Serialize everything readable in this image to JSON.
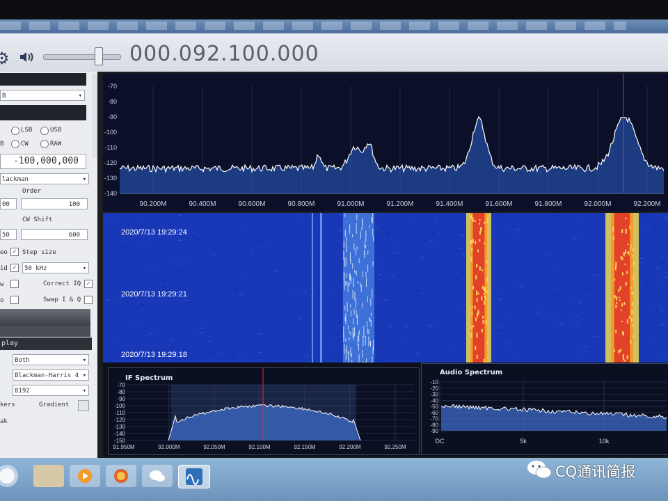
{
  "toolbar": {
    "frequency": "000.092.100.000",
    "volume_level": 0.75
  },
  "left_panel": {
    "modes": [
      "LSB",
      "USB",
      "CW",
      "RAW"
    ],
    "partial_labels": [
      "B"
    ],
    "frequency_value": "-100,000,000",
    "window_select": "lackman",
    "order_label": "Order",
    "order_value": "100",
    "filter_partial": "00",
    "cw_shift_label": "CW Shift",
    "cw_shift_value": "600",
    "cw_partial": "50",
    "step_label": "Step size",
    "step_partial_label": "eo",
    "step_size": "50 kHz",
    "id_partial": "id",
    "correct_iq": "Correct IQ",
    "correct_partial": "w",
    "swap_iq": "Swap I & Q",
    "swap_partial": "o",
    "display_header": "play",
    "display_mode": "Both",
    "fft_window": "Blackman-Harris 4",
    "fft_size": "8192",
    "markers_partial": "kers",
    "gradient_label": "Gradient",
    "peak_partial": "ak"
  },
  "main_spectrum": {
    "y_ticks": [
      "-70",
      "-80",
      "-90",
      "-100",
      "-110",
      "-120",
      "-130",
      "-140"
    ],
    "x_ticks": [
      "90.200M",
      "90.400M",
      "90.600M",
      "90.800M",
      "91.000M",
      "91.200M",
      "91.400M",
      "91.600M",
      "91.800M",
      "92.000M",
      "92.200M"
    ],
    "signal_color": "#ffffff",
    "marker_color": "#e03030"
  },
  "waterfall": {
    "timestamps": [
      "2020/7/13 19:29:24",
      "2020/7/13 19:29:21",
      "2020/7/13 19:29:18"
    ]
  },
  "if_spectrum": {
    "title": "IF Spectrum",
    "y_ticks": [
      "-70",
      "-80",
      "-90",
      "-100",
      "-110",
      "-120",
      "-130",
      "-140",
      "-150"
    ],
    "x_ticks": [
      "91.950M",
      "92.000M",
      "92.050M",
      "92.100M",
      "92.150M",
      "92.200M",
      "92.250M"
    ]
  },
  "audio_spectrum": {
    "title": "Audio Spectrum",
    "y_ticks": [
      "-10",
      "-20",
      "-30",
      "-40",
      "-50",
      "-60",
      "-70",
      "-80",
      "-90"
    ],
    "x_ticks": [
      "DC",
      "5k",
      "10k"
    ]
  },
  "watermark": {
    "text": "CQ通讯简报"
  }
}
